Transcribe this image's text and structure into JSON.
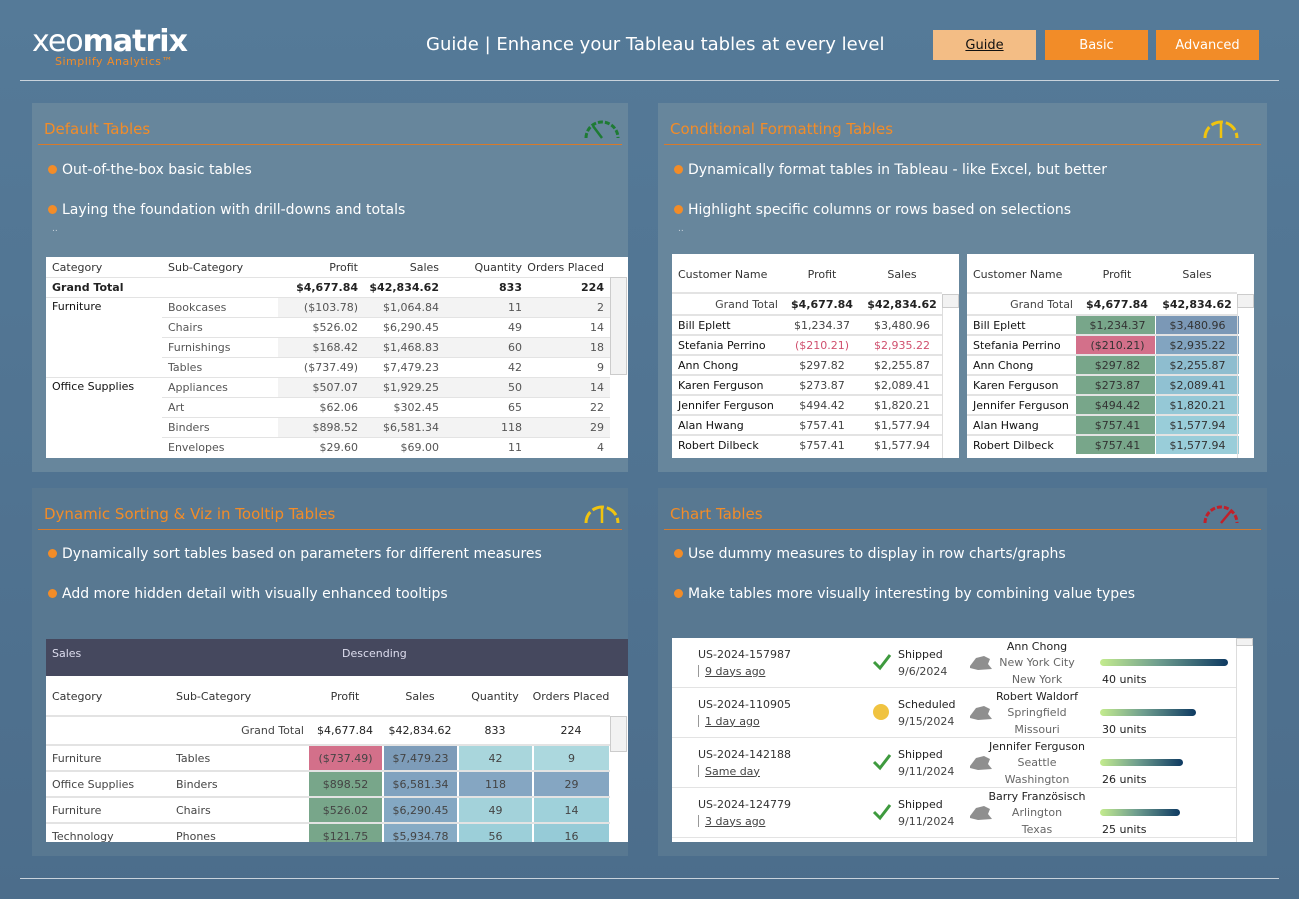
{
  "header": {
    "logo_main": "xeo",
    "logo_bold": "matrix",
    "tagline": "Simplify Analytics™",
    "title": "Guide | Enhance your Tableau tables at every level",
    "nav": [
      {
        "label": "Guide",
        "active": true
      },
      {
        "label": "Basic",
        "active": false
      },
      {
        "label": "Advanced",
        "active": false
      }
    ]
  },
  "colors": {
    "accent": "#f28c28",
    "green": "#78a68a",
    "red": "#d3708a",
    "gauge_green": "#1e7b34",
    "gauge_yellow": "#f1c40f",
    "gauge_red": "#c0202a"
  },
  "panels": {
    "default": {
      "title": "Default Tables",
      "gauge": "speedometer-low-icon",
      "bullets": [
        "Out-of-the-box basic tables",
        "Laying the foundation with drill-downs and totals"
      ],
      "extra": "..",
      "table": {
        "columns": [
          "Category",
          "Sub-Category",
          "Profit",
          "Sales",
          "Quantity",
          "Orders Placed"
        ],
        "grand_total": [
          "Grand Total",
          "",
          "$4,677.84",
          "$42,834.62",
          "833",
          "224"
        ],
        "rows": [
          [
            "Furniture",
            "Bookcases",
            "($103.78)",
            "$1,064.84",
            "11",
            "2"
          ],
          [
            "",
            "Chairs",
            "$526.02",
            "$6,290.45",
            "49",
            "14"
          ],
          [
            "",
            "Furnishings",
            "$168.42",
            "$1,468.83",
            "60",
            "18"
          ],
          [
            "",
            "Tables",
            "($737.49)",
            "$7,479.23",
            "42",
            "9"
          ],
          [
            "Office Supplies",
            "Appliances",
            "$507.07",
            "$1,929.25",
            "50",
            "14"
          ],
          [
            "",
            "Art",
            "$62.06",
            "$302.45",
            "65",
            "22"
          ],
          [
            "",
            "Binders",
            "$898.52",
            "$6,581.34",
            "118",
            "29"
          ],
          [
            "",
            "Envelopes",
            "$29.60",
            "$69.00",
            "11",
            "4"
          ]
        ]
      }
    },
    "conditional": {
      "title": "Conditional Formatting Tables",
      "gauge": "speedometer-mid-icon",
      "bullets": [
        "Dynamically format tables in Tableau - like Excel, but better",
        "Highlight specific columns or rows based on selections"
      ],
      "extra": "..",
      "table": {
        "columns": [
          "Customer Name",
          "Profit",
          "Sales"
        ],
        "grand_total": [
          "Grand Total",
          "$4,677.84",
          "$42,834.62"
        ],
        "rows": [
          [
            "Bill Eplett",
            "$1,234.37",
            "$3,480.96"
          ],
          [
            "Stefania Perrino",
            "($210.21)",
            "$2,935.22"
          ],
          [
            "Ann Chong",
            "$297.82",
            "$2,255.87"
          ],
          [
            "Karen Ferguson",
            "$273.87",
            "$2,089.41"
          ],
          [
            "Jennifer Ferguson",
            "$494.42",
            "$1,820.21"
          ],
          [
            "Alan Hwang",
            "$757.41",
            "$1,577.94"
          ],
          [
            "Robert Dilbeck",
            "$757.41",
            "$1,577.94"
          ]
        ],
        "profit_colors": [
          "#78a68a",
          "#d3708a",
          "#78a68a",
          "#78a68a",
          "#78a68a",
          "#78a68a",
          "#78a68a"
        ],
        "sales_colors": [
          "#7b98b6",
          "#82a4c0",
          "#8ebdcf",
          "#90c1d2",
          "#95c8d6",
          "#99cdd9",
          "#99cdd9"
        ]
      }
    },
    "sorting": {
      "title": "Dynamic Sorting & Viz in Tooltip Tables",
      "gauge": "speedometer-mid-icon",
      "bullets": [
        "Dynamically sort tables based on parameters for different measures",
        "Add more hidden detail with visually enhanced tooltips"
      ],
      "sort_measure": "Sales",
      "sort_order": "Descending",
      "table": {
        "columns": [
          "Category",
          "Sub-Category",
          "Profit",
          "Sales",
          "Quantity",
          "Orders Placed"
        ],
        "grand_total": [
          "",
          "Grand Total",
          "$4,677.84",
          "$42,834.62",
          "833",
          "224"
        ],
        "rows": [
          [
            "Furniture",
            "Tables",
            "($737.49)",
            "$7,479.23",
            "42",
            "9"
          ],
          [
            "Office Supplies",
            "Binders",
            "$898.52",
            "$6,581.34",
            "118",
            "29"
          ],
          [
            "Furniture",
            "Chairs",
            "$526.02",
            "$6,290.45",
            "49",
            "14"
          ],
          [
            "Technology",
            "Phones",
            "$121.75",
            "$5,934.78",
            "56",
            "16"
          ]
        ],
        "cell_colors": [
          [
            "#d3708a",
            "#7d9cb9",
            "#a9d6dc",
            "#acd8de"
          ],
          [
            "#78a68a",
            "#80a2bf",
            "#85a6c2",
            "#85a6c2"
          ],
          [
            "#78a68a",
            "#84a8c3",
            "#a3d2da",
            "#9fd1da"
          ],
          [
            "#78a68a",
            "#86abc5",
            "#9ccfd9",
            "#96cbd7"
          ]
        ]
      }
    },
    "chart": {
      "title": "Chart Tables",
      "gauge": "speedometer-high-icon",
      "bullets": [
        "Use dummy measures to display in row charts/graphs",
        "Make tables more visually interesting by combining value types"
      ],
      "orders": [
        {
          "id": "US-2024-157987",
          "ago": "9 days ago",
          "status": "Shipped",
          "status_icon": "checkmark-icon",
          "date": "9/6/2024",
          "customer": "Ann Chong",
          "city": "New York City",
          "state": "New York",
          "state_icon": "new-york-state-icon",
          "units": 40,
          "units_label": "40 units"
        },
        {
          "id": "US-2024-110905",
          "ago": "1 day ago",
          "status": "Scheduled",
          "status_icon": "yellow-circle-icon",
          "date": "9/15/2024",
          "customer": "Robert Waldorf",
          "city": "Springfield",
          "state": "Missouri",
          "state_icon": "missouri-state-icon",
          "units": 30,
          "units_label": "30 units"
        },
        {
          "id": "US-2024-142188",
          "ago": "Same day",
          "status": "Shipped",
          "status_icon": "checkmark-icon",
          "date": "9/11/2024",
          "customer": "Jennifer Ferguson",
          "city": "Seattle",
          "state": "Washington",
          "state_icon": "washington-state-icon",
          "units": 26,
          "units_label": "26 units"
        },
        {
          "id": "US-2024-124779",
          "ago": "3 days ago",
          "status": "Shipped",
          "status_icon": "checkmark-icon",
          "date": "9/11/2024",
          "customer": "Barry Französisch",
          "city": "Arlington",
          "state": "Texas",
          "state_icon": "texas-state-icon",
          "units": 25,
          "units_label": "25 units"
        }
      ]
    }
  }
}
